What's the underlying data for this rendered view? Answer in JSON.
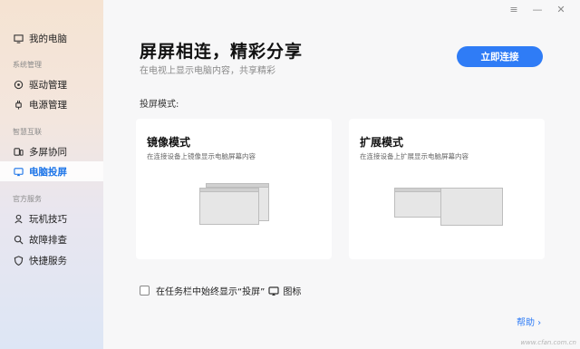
{
  "sidebar": {
    "my_pc": "我的电脑",
    "section_system": "系统管理",
    "driver": "驱动管理",
    "power": "电源管理",
    "section_smart": "智慧互联",
    "multiscreen": "多屏协同",
    "pc_cast": "电脑投屏",
    "section_service": "官方服务",
    "tips": "玩机技巧",
    "troubleshoot": "故障排查",
    "quick_service": "快捷服务"
  },
  "window_controls": {
    "menu": "≡",
    "minimize": "—",
    "close": "✕"
  },
  "main": {
    "title": "屏屏相连，精彩分享",
    "subtitle": "在电视上显示电脑内容，共享精彩",
    "connect_button": "立即连接",
    "mode_label": "投屏模式:",
    "mirror": {
      "title": "镜像模式",
      "desc": "在连接设备上镜像显示电脑屏幕内容"
    },
    "extend": {
      "title": "扩展模式",
      "desc": "在连接设备上扩展显示电脑屏幕内容"
    },
    "taskbar_option": {
      "prefix": "在任务栏中始终显示“投屏”",
      "suffix": "图标",
      "checked": false
    },
    "help": "帮助 ›"
  },
  "watermark": "www.cfan.com.cn",
  "colors": {
    "accent": "#2f7cf6"
  }
}
